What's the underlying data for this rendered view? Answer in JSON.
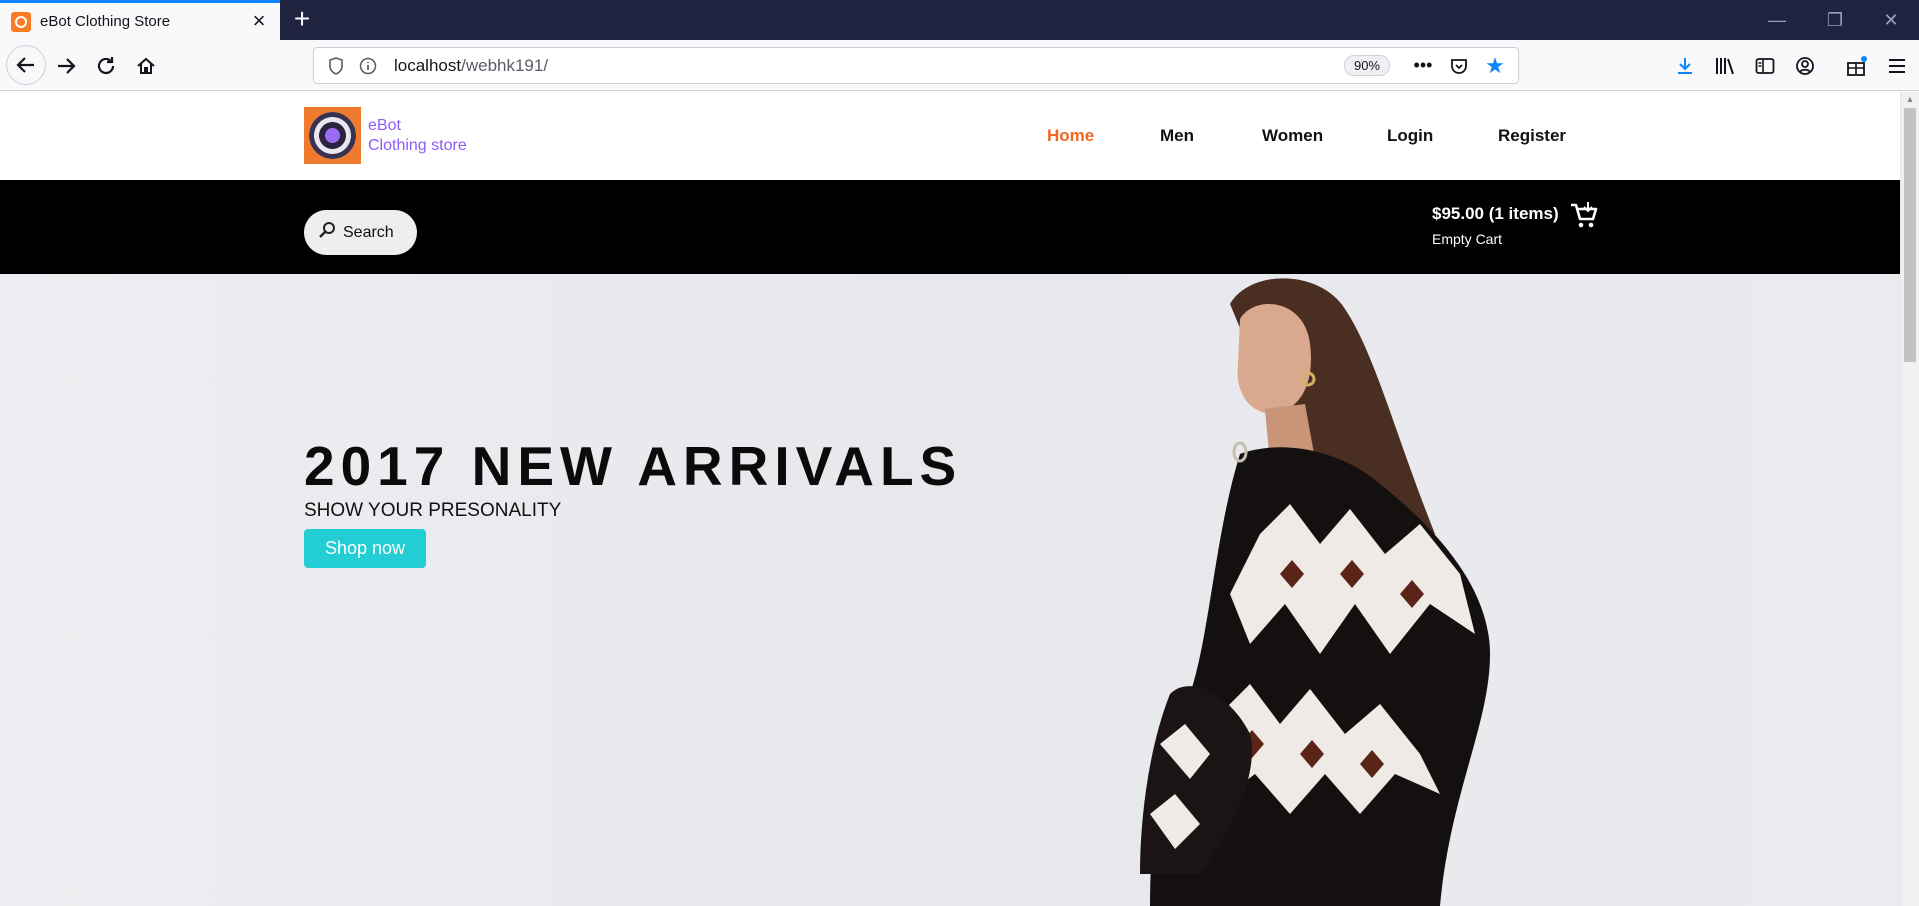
{
  "browser": {
    "tab_title": "eBot Clothing Store",
    "url_host": "localhost",
    "url_path": "/webhk191/",
    "zoom": "90%"
  },
  "site": {
    "brand_line1": "eBot",
    "brand_line2": "Clothing store",
    "nav": [
      {
        "label": "Home",
        "active": true
      },
      {
        "label": "Men",
        "active": false
      },
      {
        "label": "Women",
        "active": false
      },
      {
        "label": "Login",
        "active": false
      },
      {
        "label": "Register",
        "active": false
      }
    ],
    "search_label": "Search",
    "cart_total": "$95.00 (1 items)",
    "cart_empty": "Empty Cart"
  },
  "hero": {
    "title": "2017 NEW ARRIVALS",
    "subtitle": "SHOW YOUR PRESONALITY",
    "cta": "Shop now"
  },
  "colors": {
    "accent_nav": "#f26522",
    "cta": "#22cdd4",
    "brand": "#8b5cf6"
  }
}
